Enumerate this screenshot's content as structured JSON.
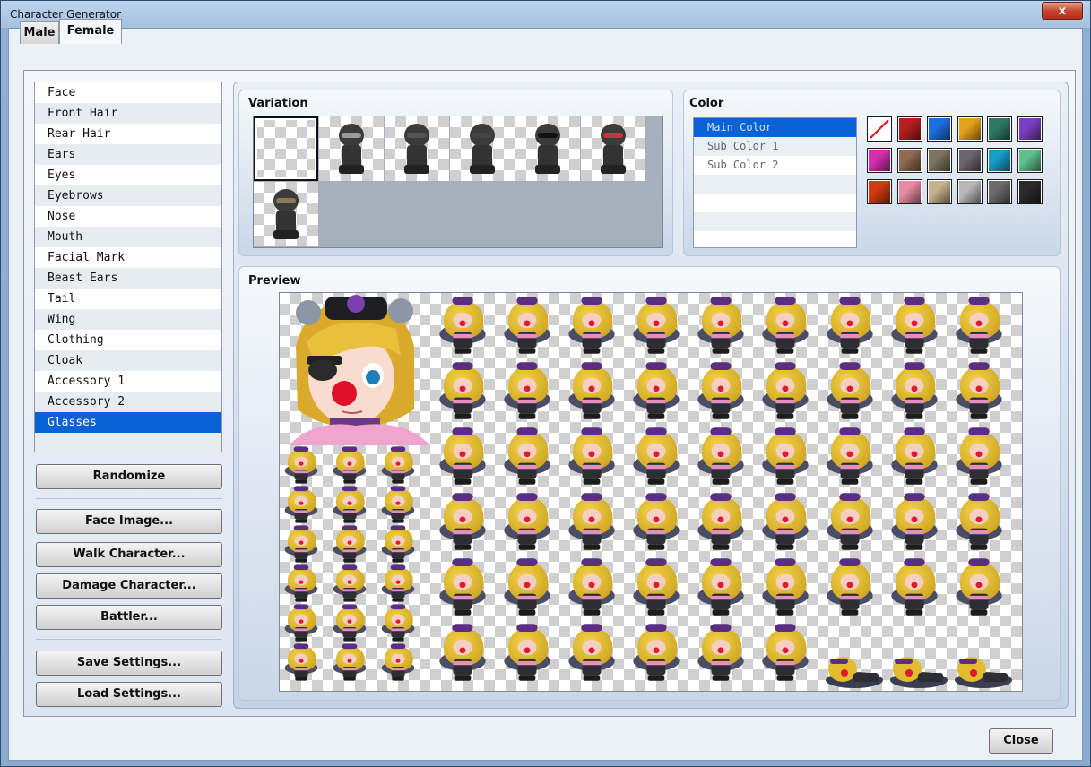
{
  "window": {
    "title": "Character Generator",
    "close_glyph": "x"
  },
  "tabs": [
    {
      "label": "Male"
    },
    {
      "label": "Female"
    }
  ],
  "parts": {
    "items": [
      "Face",
      "Front Hair",
      "Rear Hair",
      "Ears",
      "Eyes",
      "Eyebrows",
      "Nose",
      "Mouth",
      "Facial Mark",
      "Beast Ears",
      "Tail",
      "Wing",
      "Clothing",
      "Cloak",
      "Accessory 1",
      "Accessory 2",
      "Glasses"
    ],
    "selected": "Glasses"
  },
  "buttons": {
    "randomize": "Randomize",
    "face_image": "Face Image...",
    "walk_character": "Walk Character...",
    "damage_character": "Damage Character...",
    "battler": "Battler...",
    "save_settings": "Save Settings...",
    "load_settings": "Load Settings...",
    "close": "Close"
  },
  "variation": {
    "title": "Variation",
    "selected_index": 0,
    "glasses_colors": [
      "",
      "#9a9a9a",
      "#555555",
      "#444444",
      "#111111",
      "#d0303a",
      "#8a7a55"
    ]
  },
  "color": {
    "title": "Color",
    "targets": [
      "Main Color",
      "Sub Color 1",
      "Sub Color 2"
    ],
    "selected": "Main Color",
    "swatches": [
      "none",
      "#b51f1f",
      "#1c6fe0",
      "#e6a21a",
      "#2f7a66",
      "#7a3fc3",
      "#d42fae",
      "#8e6a52",
      "#7b7560",
      "#6e6470",
      "#1a9bc9",
      "#5fc08d",
      "#d33a10",
      "#e98aa4",
      "#c7b28e",
      "#b8b8b8",
      "#6b6b6b",
      "#2a2a2a"
    ]
  },
  "preview": {
    "title": "Preview"
  }
}
